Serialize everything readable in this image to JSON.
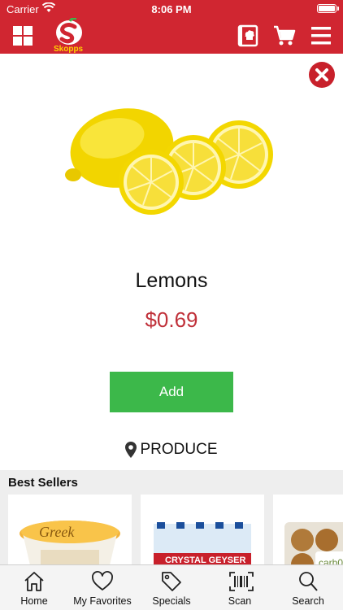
{
  "status_bar": {
    "carrier": "Carrier",
    "time": "8:06 PM"
  },
  "header": {
    "logo_text": "Skopps",
    "icons": [
      "grid-menu-icon",
      "chef-recipe-icon",
      "cart-icon",
      "hamburger-menu-icon"
    ]
  },
  "product": {
    "name": "Lemons",
    "price": "$0.69",
    "add_label": "Add",
    "location": "PRODUCE"
  },
  "best_sellers": {
    "heading": "Best Sellers",
    "items": [
      "Greek yogurt cup",
      "Crystal Geyser water bottles",
      "Carbon muffins pack"
    ]
  },
  "tabs": [
    {
      "label": "Home",
      "icon": "home-icon"
    },
    {
      "label": "My Favorites",
      "icon": "heart-icon"
    },
    {
      "label": "Specials",
      "icon": "tag-icon"
    },
    {
      "label": "Scan",
      "icon": "barcode-icon"
    },
    {
      "label": "Search",
      "icon": "search-icon"
    }
  ],
  "colors": {
    "brand_red": "#d02631",
    "price_red": "#c0313a",
    "add_green": "#3cb84a"
  }
}
